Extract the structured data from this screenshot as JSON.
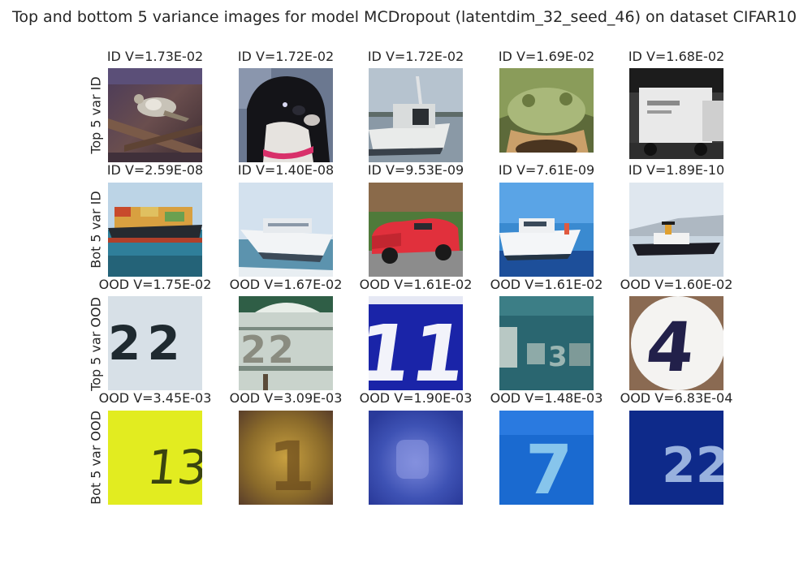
{
  "figure": {
    "title": "Top and bottom 5 variance images for model MCDropout (latentdim_32_seed_46) on dataset CIFAR10"
  },
  "rows": [
    {
      "label": "Top 5 var ID",
      "cells": [
        {
          "title": "ID V=1.73E-02",
          "icon": "bird-image"
        },
        {
          "title": "ID V=1.72E-02",
          "icon": "dog-image"
        },
        {
          "title": "ID V=1.72E-02",
          "icon": "boat-image"
        },
        {
          "title": "ID V=1.69E-02",
          "icon": "frog-image"
        },
        {
          "title": "ID V=1.68E-02",
          "icon": "truck-image"
        }
      ]
    },
    {
      "label": "Bot 5 var ID",
      "cells": [
        {
          "title": "ID V=2.59E-08",
          "icon": "container-ship-image"
        },
        {
          "title": "ID V=1.40E-08",
          "icon": "ship-image"
        },
        {
          "title": "ID V=9.53E-09",
          "icon": "red-car-image"
        },
        {
          "title": "ID V=7.61E-09",
          "icon": "boat-image"
        },
        {
          "title": "ID V=1.89E-10",
          "icon": "ship-image"
        }
      ]
    },
    {
      "label": "Top 5 var OOD",
      "cells": [
        {
          "title": "OOD V=1.75E-02",
          "icon": "house-number-image"
        },
        {
          "title": "OOD V=1.67E-02",
          "icon": "house-number-image"
        },
        {
          "title": "OOD V=1.61E-02",
          "icon": "house-number-image"
        },
        {
          "title": "OOD V=1.61E-02",
          "icon": "house-number-image"
        },
        {
          "title": "OOD V=1.60E-02",
          "icon": "house-number-image"
        }
      ]
    },
    {
      "label": "Bot 5 var OOD",
      "cells": [
        {
          "title": "OOD V=3.45E-03",
          "icon": "house-number-image"
        },
        {
          "title": "OOD V=3.09E-03",
          "icon": "house-number-image"
        },
        {
          "title": "OOD V=1.90E-03",
          "icon": "house-number-image"
        },
        {
          "title": "OOD V=1.48E-03",
          "icon": "house-number-image"
        },
        {
          "title": "OOD V=6.83E-04",
          "icon": "house-number-image"
        }
      ]
    }
  ],
  "digits": {
    "r2c0": "22",
    "r2c1": "22",
    "r2c2": "11",
    "r2c3": "3",
    "r2c4": "4",
    "r3c0": "13",
    "r3c1": "1",
    "r3c3": "7",
    "r3c4": "22"
  }
}
